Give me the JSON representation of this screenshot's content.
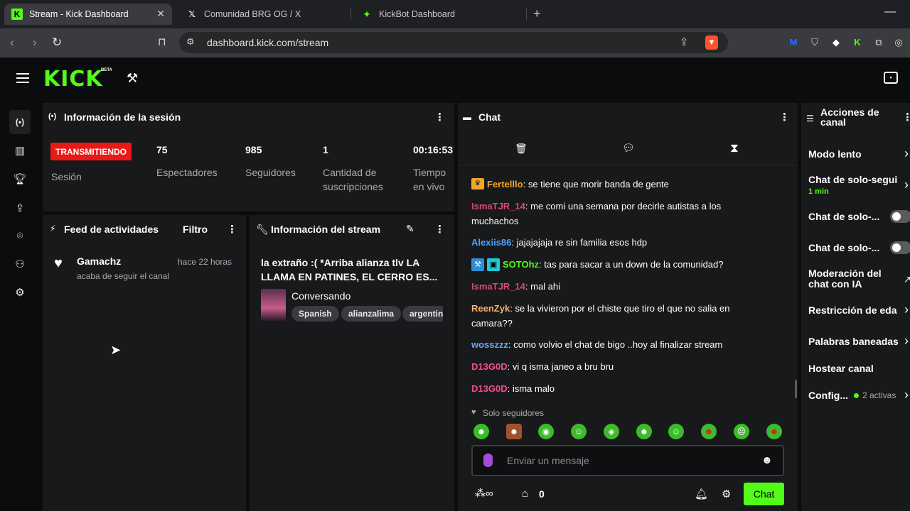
{
  "browser": {
    "tabs": [
      {
        "title": "Stream - Kick Dashboard",
        "active": true
      },
      {
        "title": "Comunidad BRG OG / X",
        "active": false
      },
      {
        "title": "KickBot Dashboard",
        "active": false
      }
    ],
    "url": "dashboard.kick.com/stream"
  },
  "header": {
    "logo": "KICK",
    "logo_badge": "BETA"
  },
  "session": {
    "title": "Información de la sesión",
    "status_badge": "TRANSMITIENDO",
    "session_label": "Sesión",
    "viewers": "75",
    "viewers_label": "Espectadores",
    "followers": "985",
    "followers_label": "Seguidores",
    "subs": "1",
    "subs_label": "Cantidad de suscripciones",
    "uptime": "00:16:53",
    "uptime_label": "Tiempo en vivo"
  },
  "feed": {
    "title": "Feed de actividades",
    "filter_label": "Filtro",
    "items": [
      {
        "user": "Gamachz",
        "time": "hace 22 horas",
        "action": "acaba de seguir el canal"
      }
    ]
  },
  "stream_info": {
    "title": "Información del stream",
    "stream_title": "la extraño :( *Arriba alianza tlv LA LLAMA EN PATINES, EL CERRO ES...",
    "category": "Conversando",
    "tags": [
      "Spanish",
      "alianzalima",
      "argentin"
    ]
  },
  "chat": {
    "title": "Chat",
    "messages": [
      {
        "user": "Fertelllo",
        "color": "#f5a623",
        "text": "se tiene que morir banda de gente"
      },
      {
        "user": "IsmaTJR_14",
        "color": "#e0457b",
        "text": "me comi una semana por decirle autistas a los muchachos"
      },
      {
        "user": "Alexiis86",
        "color": "#4aa3ff",
        "text": "jajajajaja re sin familia esos hdp"
      },
      {
        "user": "SOTOhz",
        "color": "#53fc18",
        "text": "tas para sacar a un down de la comunidad?"
      },
      {
        "user": "IsmaTJR_14",
        "color": "#e0457b",
        "text": "mal ahi"
      },
      {
        "user": "ReenZyk",
        "color": "#f2b36b",
        "text": "se la vivieron por el chiste que tiro el que no salia en camara??"
      },
      {
        "user": "wosszzz",
        "color": "#6aa7ff",
        "text": "como volvio el chat de bigo ..hoy al finalizar stream"
      },
      {
        "user": "D13G0D",
        "color": "#f0508a",
        "text": "vi q isma janeo a bru bru"
      },
      {
        "user": "D13G0D",
        "color": "#f0508a",
        "text": "isma malo"
      }
    ],
    "mode_label": "Solo seguidores",
    "input_placeholder": "Enviar un mensaje",
    "points": "0",
    "send_label": "Chat"
  },
  "actions": {
    "title": "Acciones de canal",
    "items": [
      {
        "label": "Modo lento",
        "sub": ""
      },
      {
        "label": "Chat de solo-segui",
        "sub": "1 min"
      },
      {
        "label": "Chat de solo-...",
        "sub": ""
      },
      {
        "label": "Chat de solo-...",
        "sub": ""
      },
      {
        "label": "Moderación del chat con IA",
        "sub": ""
      },
      {
        "label": "Restricción de eda",
        "sub": ""
      },
      {
        "label": "Palabras baneadas",
        "sub": ""
      },
      {
        "label": "Hostear canal",
        "sub": ""
      },
      {
        "label": "Config...",
        "sub": "2 activas"
      }
    ]
  },
  "colors": {
    "brand": "#53fc18",
    "live": "#e91916",
    "panel": "#18191b"
  }
}
